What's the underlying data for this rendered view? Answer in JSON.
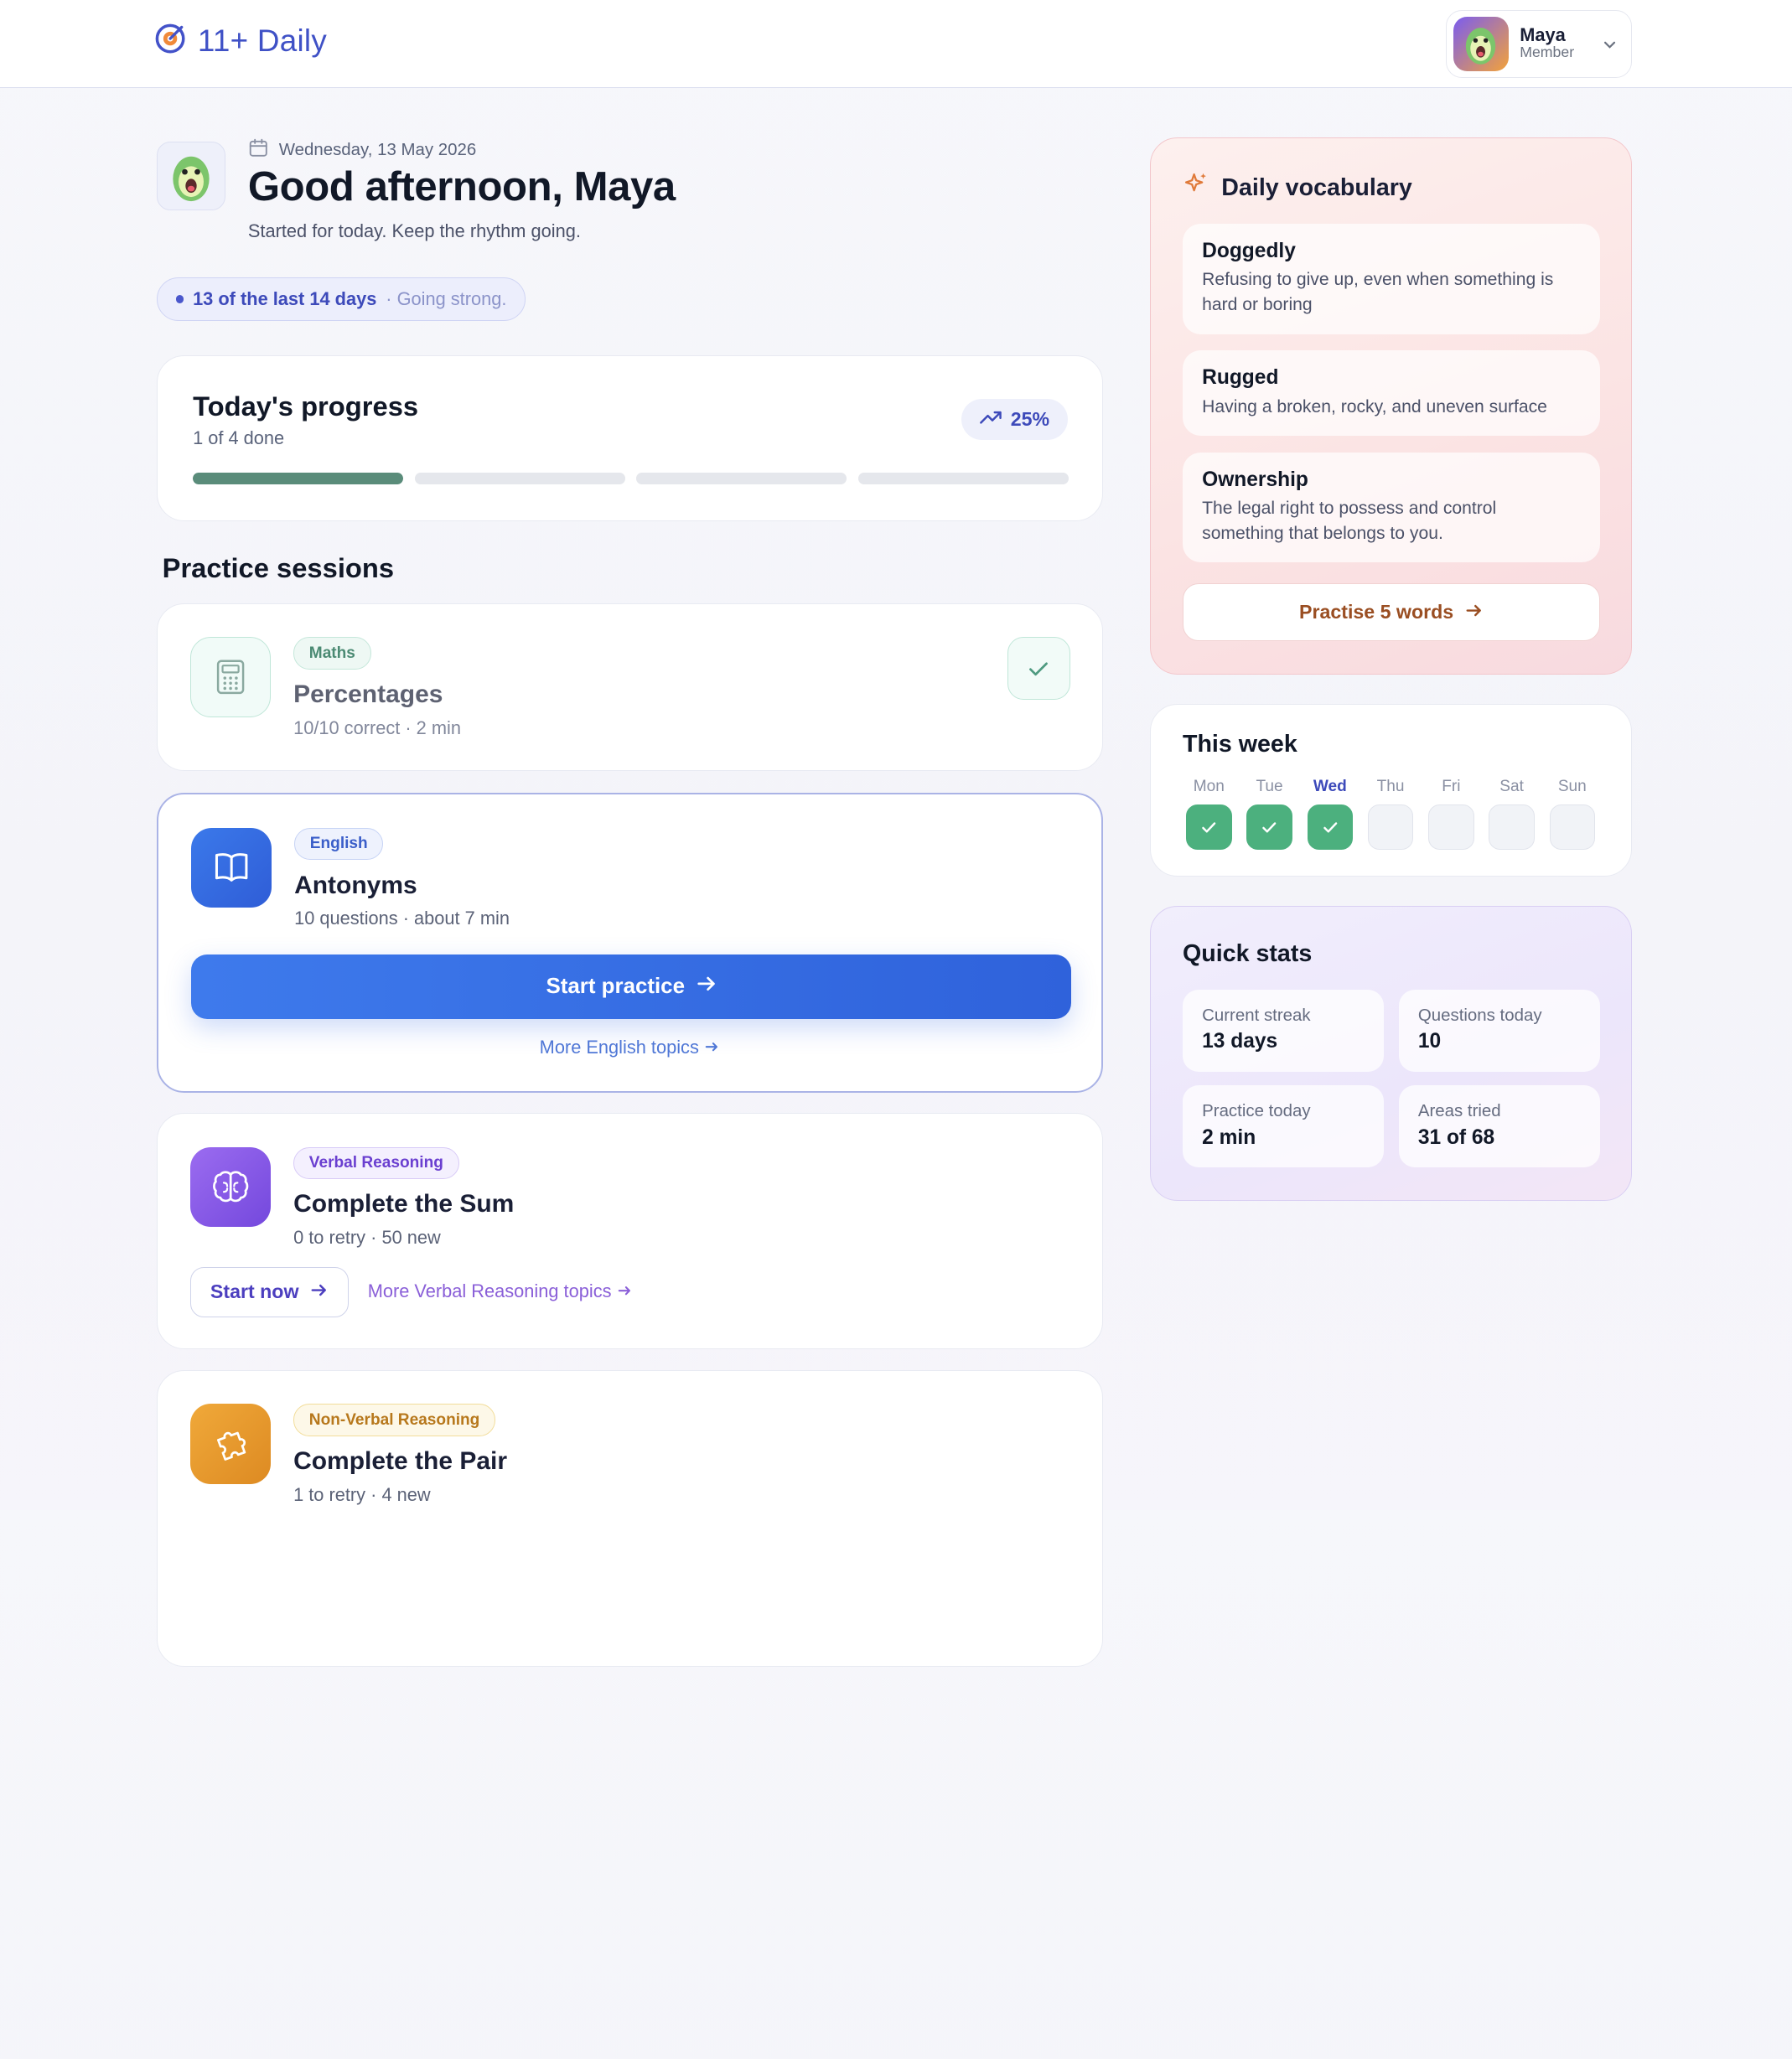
{
  "header": {
    "brand": "11+ Daily",
    "user": {
      "name": "Maya",
      "role": "Member"
    }
  },
  "greeting": {
    "date": "Wednesday, 13 May 2026",
    "title": "Good afternoon, Maya",
    "subtitle": "Started for today. Keep the rhythm going.",
    "streak_main": "13 of the last 14 days",
    "streak_sub": "· Going strong."
  },
  "progress": {
    "title": "Today's progress",
    "subtitle": "1 of 4 done",
    "badge": "25%",
    "percent": 0.25,
    "segments": [
      1,
      0,
      0,
      0
    ]
  },
  "practice": {
    "title": "Practice sessions",
    "sessions": [
      {
        "tag": "Maths",
        "title": "Percentages",
        "meta": "10/10 correct · 2 min",
        "status": "done"
      },
      {
        "tag": "English",
        "title": "Antonyms",
        "meta": "10 questions · about 7 min",
        "button": "Start practice",
        "link": "More English topics"
      },
      {
        "tag": "Verbal Reasoning",
        "title": "Complete the Sum",
        "meta": "0 to retry · 50 new",
        "button": "Start now",
        "link": "More Verbal Reasoning topics"
      },
      {
        "tag": "Non-Verbal Reasoning",
        "title": "Complete the Pair",
        "meta": "1 to retry · 4 new"
      }
    ]
  },
  "vocabulary": {
    "title": "Daily vocabulary",
    "words": [
      {
        "word": "Doggedly",
        "definition": "Refusing to give up, even when something is hard or boring"
      },
      {
        "word": "Rugged",
        "definition": "Having a broken, rocky, and uneven surface"
      },
      {
        "word": "Ownership",
        "definition": "The legal right to possess and control something that belongs to you."
      }
    ],
    "button": "Practise 5 words"
  },
  "week": {
    "title": "This week",
    "days": [
      {
        "label": "Mon",
        "done": true
      },
      {
        "label": "Tue",
        "done": true
      },
      {
        "label": "Wed",
        "done": true,
        "today": true
      },
      {
        "label": "Thu",
        "done": false
      },
      {
        "label": "Fri",
        "done": false
      },
      {
        "label": "Sat",
        "done": false
      },
      {
        "label": "Sun",
        "done": false
      }
    ]
  },
  "stats": {
    "title": "Quick stats",
    "items": [
      {
        "label": "Current streak",
        "value": "13 days"
      },
      {
        "label": "Questions today",
        "value": "10"
      },
      {
        "label": "Practice today",
        "value": "2 min"
      },
      {
        "label": "Areas tried",
        "value": "31 of 68"
      }
    ]
  },
  "colors": {
    "brand": "#3f51c6",
    "progress_fill": "#5a8c7a",
    "english_accent": "#2f62db",
    "verbal_accent": "#7448dd",
    "nonverbal_accent": "#dd8a22",
    "done_green": "#4cb07e"
  }
}
